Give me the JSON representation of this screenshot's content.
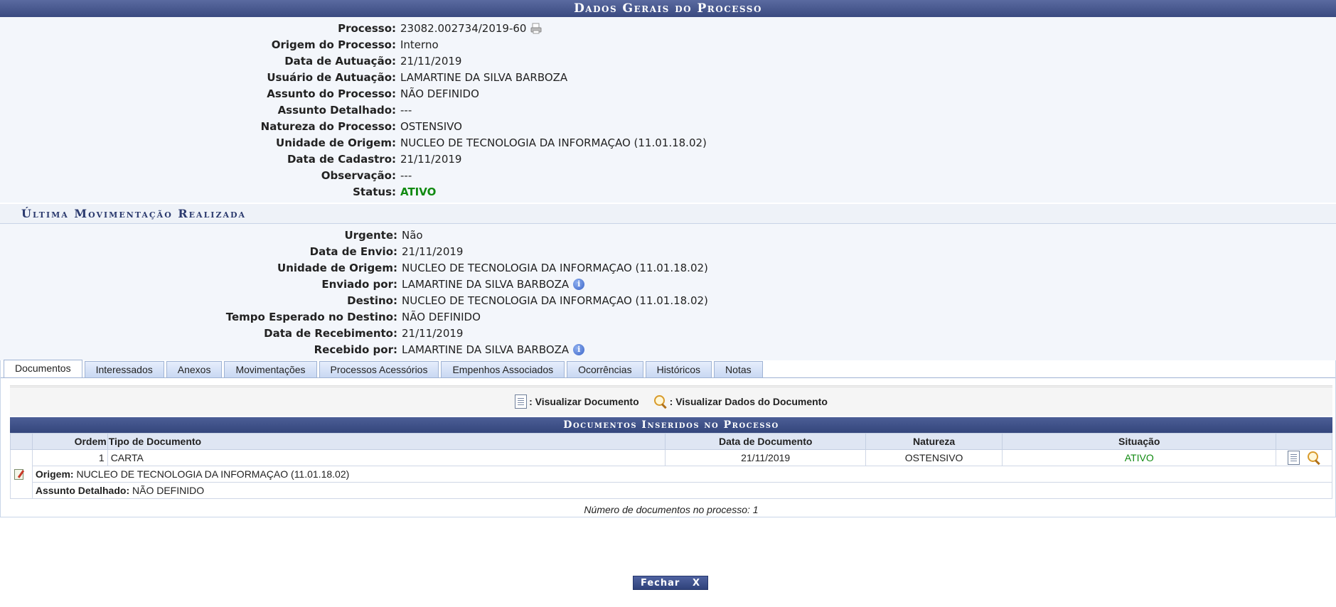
{
  "header": {
    "title": "Dados Gerais do Processo"
  },
  "general": {
    "rows": [
      {
        "label": "Processo:",
        "value": "23082.002734/2019-60"
      },
      {
        "label": "Origem do Processo:",
        "value": "Interno"
      },
      {
        "label": "Data de Autuação:",
        "value": "21/11/2019"
      },
      {
        "label": "Usuário de Autuação:",
        "value": "LAMARTINE DA SILVA BARBOZA"
      },
      {
        "label": "Assunto do Processo:",
        "value": "NÃO DEFINIDO"
      },
      {
        "label": "Assunto Detalhado:",
        "value": "---"
      },
      {
        "label": "Natureza do Processo:",
        "value": "OSTENSIVO"
      },
      {
        "label": "Unidade de Origem:",
        "value": "NUCLEO DE TECNOLOGIA DA INFORMAÇAO (11.01.18.02)"
      },
      {
        "label": "Data de Cadastro:",
        "value": "21/11/2019"
      },
      {
        "label": "Observação:",
        "value": "---"
      },
      {
        "label": "Status:",
        "value": "ATIVO"
      }
    ]
  },
  "movement": {
    "title": "Última Movimentação Realizada",
    "rows": [
      {
        "label": "Urgente:",
        "value": "Não"
      },
      {
        "label": "Data de Envio:",
        "value": "21/11/2019"
      },
      {
        "label": "Unidade de Origem:",
        "value": "NUCLEO DE TECNOLOGIA DA INFORMAÇAO (11.01.18.02)"
      },
      {
        "label": "Enviado por:",
        "value": "LAMARTINE DA SILVA BARBOZA"
      },
      {
        "label": "Destino:",
        "value": "NUCLEO DE TECNOLOGIA DA INFORMAÇAO (11.01.18.02)"
      },
      {
        "label": "Tempo Esperado no Destino:",
        "value": "NÃO DEFINIDO"
      },
      {
        "label": "Data de Recebimento:",
        "value": "21/11/2019"
      },
      {
        "label": "Recebido por:",
        "value": "LAMARTINE DA SILVA BARBOZA"
      }
    ]
  },
  "tabs": [
    {
      "label": "Documentos",
      "active": true
    },
    {
      "label": "Interessados"
    },
    {
      "label": "Anexos"
    },
    {
      "label": "Movimentações"
    },
    {
      "label": "Processos Acessórios"
    },
    {
      "label": "Empenhos Associados"
    },
    {
      "label": "Ocorrências"
    },
    {
      "label": "Históricos"
    },
    {
      "label": "Notas"
    }
  ],
  "legend": {
    "view_document": ": Visualizar Documento",
    "view_document_data": ": Visualizar Dados do Documento"
  },
  "documents": {
    "title": "Documentos Inseridos no Processo",
    "columns": {
      "ordem": "Ordem",
      "tipo": "Tipo de Documento",
      "data": "Data de Documento",
      "natureza": "Natureza",
      "situacao": "Situação"
    },
    "rows": [
      {
        "ordem": "1",
        "tipo": "CARTA",
        "data": "21/11/2019",
        "natureza": "OSTENSIVO",
        "situacao": "ATIVO",
        "origem_label": "Origem:",
        "origem": "NUCLEO DE TECNOLOGIA DA INFORMAÇAO (11.01.18.02)",
        "assunto_label": "Assunto Detalhado:",
        "assunto": "NÃO DEFINIDO"
      }
    ],
    "count_text": "Número de documentos no processo: 1"
  },
  "footer": {
    "close_label": "Fechar",
    "close_x": "X"
  },
  "colors": {
    "status_active": "#118a11",
    "header_bg": "#3a4a80"
  },
  "icons": {
    "print": "print-icon",
    "info": "info-icon",
    "view_doc": "document-icon",
    "view_data": "magnifier-icon",
    "edit": "edit-icon"
  }
}
